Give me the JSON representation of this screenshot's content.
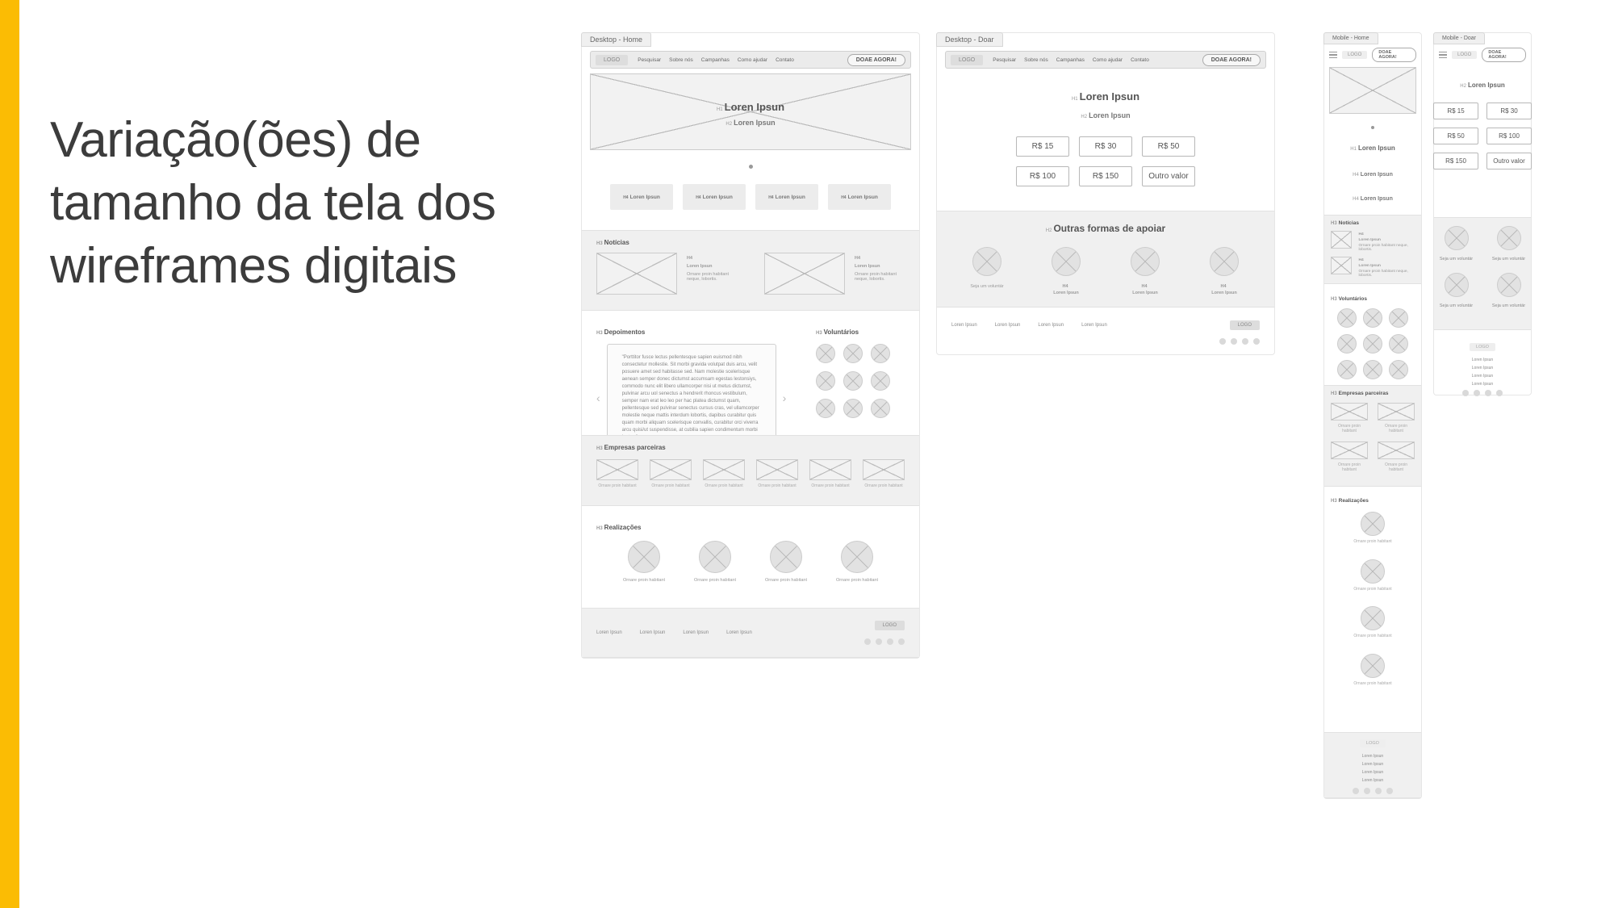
{
  "slide_title": "Variação(ões) de tamanho da tela dos wireframes digitais",
  "tabs": {
    "desktop_home": "Desktop - Home",
    "desktop_doar": "Desktop - Doar",
    "mobile_home": "Mobile - Home",
    "mobile_doar": "Mobile - Doar"
  },
  "common": {
    "logo": "LOGO",
    "nav": [
      "Pesquisar",
      "Sobre nós",
      "Campanhas",
      "Como ajudar",
      "Contato"
    ],
    "cta": "DOAE AGORA!",
    "h_h1": "H1",
    "h_h2": "H2",
    "h_h3": "H3",
    "h_h4": "H4",
    "lorem": "Loren Ipsun",
    "lorem_news_caption": "Ornare proin habitant neque, lobortis.",
    "partner_caption": "Ornare proin habitant",
    "sec_noticias": "Notícias",
    "sec_depoimentos": "Depoimentos",
    "sec_voluntarios": "Voluntários",
    "sec_empresas": "Empresas parceiras",
    "sec_realizacoes": "Realizações",
    "testimonial": "\"Porttitor fusce lectus pellentesque sapien euismod nibh consectetur mollestie. Sit morbi gravida volutpat duis arcu, velit posuere amet sed habitasse sed. Nam molestie scelerisque aenean semper donec dictumst accumsam egestas lestonsiys, commodo nunc elit libero ullamcorper nisi ut metus dictumst, pulvinar arcu uol senectus a hendrerit rhoncus vestibulum, semper nam erat leo leo per hac platea dictumst quam, pellentesque sed pulvinar senectus cursus cras, vel ullamcorper molestie neque mattis interdum lobortis, dapibus curabitur quis quam morbi aliquam scelerisque convallis, curabitur orci viverra arcu quisi/ut suspendisse, at cubilia sapien condimentum morbi luctus.\""
  },
  "doar": {
    "sec_outras": "Outras formas de apoiar",
    "amounts": [
      "R$ 15",
      "R$ 30",
      "R$ 50",
      "R$ 100",
      "R$ 150",
      "Outro valor"
    ],
    "support": [
      {
        "title": "Seja um voluntár"
      },
      {
        "title": "Loren Ipsun"
      },
      {
        "title": "Loren Ipsun"
      },
      {
        "title": "Loren Ipsun"
      }
    ],
    "footer_links": [
      "Loren Ipsun",
      "Loren Ipsun",
      "Loren Ipsun",
      "Loren Ipsun"
    ]
  },
  "mobile_doar_support": [
    "Seja um voluntár",
    "Seja um voluntár",
    "Seja um voluntár",
    "Seja um voluntár"
  ]
}
